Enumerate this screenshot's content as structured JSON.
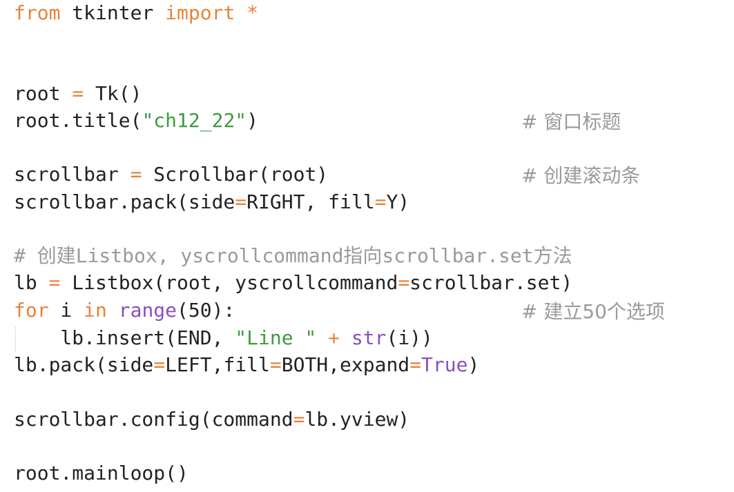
{
  "code": {
    "l1": {
      "kw_from": "from",
      "mod": " tkinter ",
      "kw_import": "import",
      "sp": " ",
      "star": "*"
    },
    "l4": {
      "a": "root ",
      "eq": "=",
      "b": " Tk()"
    },
    "l5": {
      "a": "root.title(",
      "s": "\"ch12_22\"",
      "b": ")",
      "comment": "# 窗口标题"
    },
    "l7": {
      "a": "scrollbar ",
      "eq": "=",
      "b": " Scrollbar(root)",
      "comment": "# 创建滚动条"
    },
    "l8": {
      "a": "scrollbar.pack(side",
      "eq": "=",
      "b": "RIGHT, fill",
      "eq2": "=",
      "c": "Y)"
    },
    "l10": {
      "comment": "# 创建Listbox, yscrollcommand指向scrollbar.set方法"
    },
    "l11": {
      "a": "lb ",
      "eq": "=",
      "b": " Listbox(root, yscrollcommand",
      "eq2": "=",
      "c": "scrollbar.set)"
    },
    "l12": {
      "kw_for": "for",
      "a": " i ",
      "kw_in": "in",
      "sp": " ",
      "range": "range",
      "b": "(50):",
      "comment": "# 建立50个选项"
    },
    "l13": {
      "a": "    lb.insert(END, ",
      "s": "\"Line \"",
      "sp": " ",
      "plus": "+",
      "sp2": " ",
      "str": "str",
      "b": "(i))"
    },
    "l14": {
      "a": "lb.pack(side",
      "eq": "=",
      "b": "LEFT,fill",
      "eq2": "=",
      "c": "BOTH,expand",
      "eq3": "=",
      "t": "True",
      "d": ")"
    },
    "l16": {
      "a": "scrollbar.config(command",
      "eq": "=",
      "b": "lb.yview)"
    },
    "l18": {
      "a": "root.mainloop()"
    }
  },
  "colors": {
    "keyword": "#e8833a",
    "string": "#3e9a3e",
    "builtin": "#8a4fbe",
    "comment": "#9a9a9a",
    "text": "#222222"
  }
}
